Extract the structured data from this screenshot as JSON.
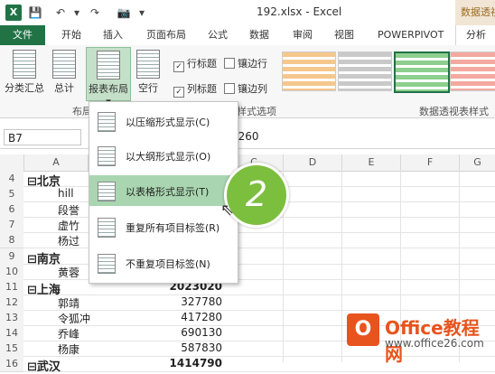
{
  "window": {
    "title": "192.xlsx - Excel",
    "context_tab_group": "数据透视表工具",
    "app_icon_letter": "X"
  },
  "qat": {
    "save": "💾",
    "undo": "↶",
    "redo": "↷",
    "camera": "📷",
    "more": "▾"
  },
  "tabs": {
    "file": "文件",
    "items": [
      "开始",
      "插入",
      "页面布局",
      "公式",
      "数据",
      "审阅",
      "视图",
      "POWERPIVOT"
    ],
    "analyze": "分析"
  },
  "ribbon": {
    "subtotals": "分类汇总",
    "grand_totals": "总计",
    "report_layout": "报表布局",
    "blank_rows": "空行",
    "dropdown_caret": "▾",
    "checkboxes": [
      {
        "label": "行标题",
        "checked": true
      },
      {
        "label": "镶边行",
        "checked": false
      },
      {
        "label": "列标题",
        "checked": true
      },
      {
        "label": "镶边列",
        "checked": false
      }
    ],
    "group_layout": "布局",
    "group_style_options": "样式选项",
    "group_styles": "数据透视表样式"
  },
  "formula_bar": {
    "name_box": "B7",
    "value": "3260"
  },
  "columns": [
    "A",
    "B",
    "C",
    "D",
    "E",
    "F",
    "G"
  ],
  "rows": [
    {
      "num": "4",
      "a": "⊟北京",
      "b": "",
      "bold": true
    },
    {
      "num": "5",
      "a": "hill",
      "b": ""
    },
    {
      "num": "6",
      "a": "段誉",
      "b": ""
    },
    {
      "num": "7",
      "a": "虚竹",
      "b": ""
    },
    {
      "num": "8",
      "a": "杨过",
      "b": ""
    },
    {
      "num": "9",
      "a": "⊟南京",
      "b": "",
      "bold": true
    },
    {
      "num": "10",
      "a": "黄蓉",
      "b": ""
    },
    {
      "num": "11",
      "a": "⊟上海",
      "b": "2023020",
      "bold": true
    },
    {
      "num": "12",
      "a": "郭靖",
      "b": "327780"
    },
    {
      "num": "13",
      "a": "令狐冲",
      "b": "417280"
    },
    {
      "num": "14",
      "a": "乔峰",
      "b": "690130"
    },
    {
      "num": "15",
      "a": "杨康",
      "b": "587830"
    },
    {
      "num": "16",
      "a": "⊟武汉",
      "b": "1414790",
      "bold": true
    }
  ],
  "menu": {
    "items": [
      {
        "label": "以压缩形式显示(C)",
        "selected": false
      },
      {
        "label": "以大纲形式显示(O)",
        "selected": false
      },
      {
        "label": "以表格形式显示(T)",
        "selected": true
      },
      {
        "label": "重复所有项目标签(R)",
        "selected": false
      },
      {
        "label": "不重复项目标签(N)",
        "selected": false
      }
    ]
  },
  "annotation": {
    "step": "2"
  },
  "watermark": {
    "logo_letter": "O",
    "title": "Office教程网",
    "url": "www.office26.com"
  },
  "colors": {
    "excel_green": "#217346",
    "menu_selected": "#a9d6b0",
    "step_green": "#7cbf3f",
    "watermark_orange": "#e8541e"
  }
}
